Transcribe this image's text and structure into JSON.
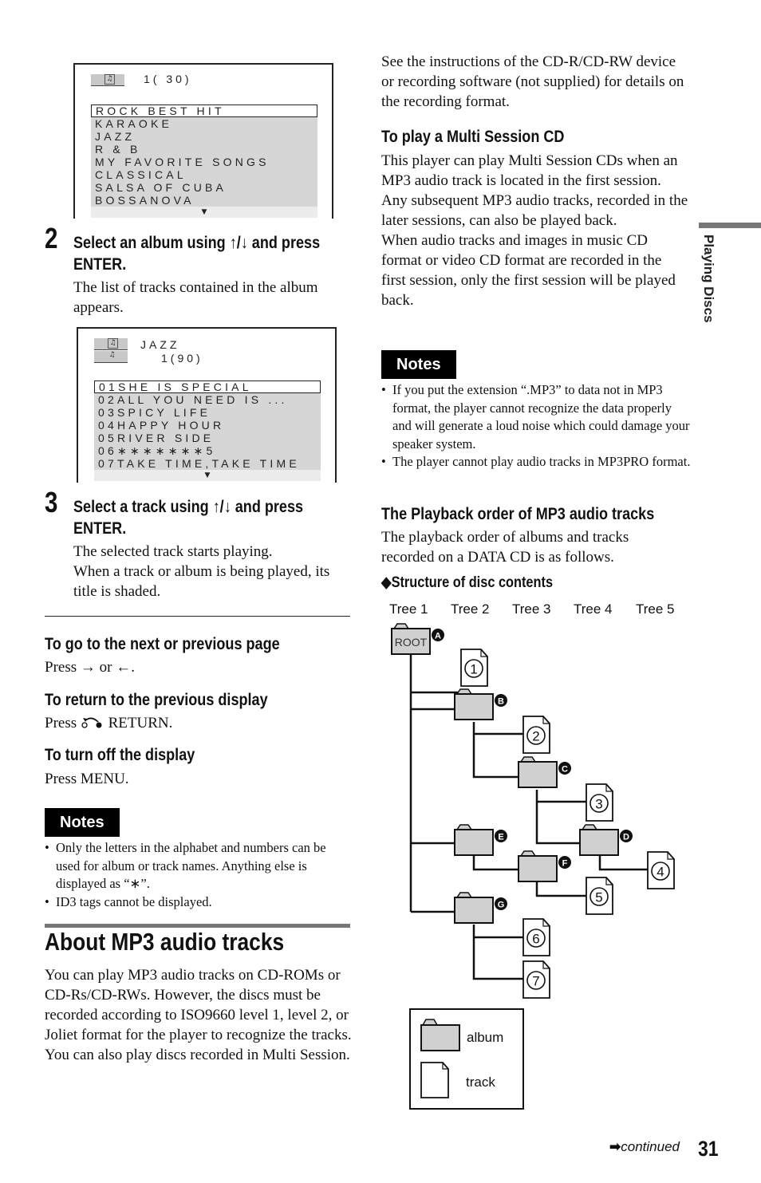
{
  "screen1": {
    "header_count": "1( 30)",
    "albums": [
      "ROCK BEST HIT",
      "KARAOKE",
      "JAZZ",
      "R & B",
      "MY FAVORITE SONGS",
      "CLASSICAL",
      "SALSA OF CUBA",
      "BOSSANOVA"
    ],
    "selected_index": 0,
    "more_indicator": "▼"
  },
  "step2": {
    "number": "2",
    "heading": "Select an album using ↑/↓ and press ENTER.",
    "heading_line1": "Select an album using ↑/↓ and press",
    "heading_line2": "ENTER.",
    "body_line1": "The list of tracks contained in the album",
    "body_line2": "appears."
  },
  "screen2": {
    "album_name": "JAZZ",
    "header_count": "1(90)",
    "tracks": [
      "01SHE IS SPECIAL",
      "02ALL YOU NEED IS ...",
      "03SPICY LIFE",
      "04HAPPY HOUR",
      "05RIVER SIDE",
      "06∗∗∗∗∗∗∗5",
      "07TAKE TIME,TAKE TIME"
    ],
    "selected_index": 0,
    "more_indicator": "▼"
  },
  "step3": {
    "number": "3",
    "heading_line1": "Select a track using ↑/↓ and press",
    "heading_line2": "ENTER.",
    "body_line1": "The selected track starts playing.",
    "body_line2": "When a track or album is being played, its",
    "body_line3": "title is shaded."
  },
  "tips": [
    {
      "heading": "To go to the next or previous page",
      "body": "Press → or ←."
    },
    {
      "heading": "To return to the previous display",
      "body_prefix": "Press",
      "body_suffix": "RETURN.",
      "icon": "return-icon"
    },
    {
      "heading": "To turn off the display",
      "body": "Press MENU."
    }
  ],
  "notes_left": {
    "badge": "Notes",
    "items": [
      "Only the letters in the alphabet and numbers can be used for album or track names. Anything else is displayed as “∗”.",
      "ID3 tags cannot be displayed."
    ]
  },
  "about": {
    "title": "About MP3 audio tracks",
    "para1": "You can play MP3 audio tracks on CD-ROMs or CD-Rs/CD-RWs. However, the discs must be recorded according to ISO9660 level 1, level 2, or Joliet format for the player to recognize the tracks.",
    "para2": "You can also play discs recorded in Multi Session."
  },
  "right": {
    "intro": "See the instructions of the CD-R/CD-RW device or recording software (not supplied) for details on the recording format.",
    "multi_session_heading": "To play a Multi Session CD",
    "multi_session_p1": "This player can play Multi Session CDs when an MP3 audio track is located in the first session. Any subsequent MP3 audio tracks, recorded in the later sessions, can also be played back.",
    "multi_session_p2": "When audio tracks and images in music CD format or video CD format are recorded in the first session, only the first session will be played back."
  },
  "notes_right": {
    "badge": "Notes",
    "items": [
      "If you put the extension “.MP3” to data not in MP3 format, the player cannot recognize the data properly and will generate a loud noise which could damage your speaker system.",
      "The player cannot play audio tracks in MP3PRO format."
    ]
  },
  "playback": {
    "heading": "The Playback order of MP3 audio tracks",
    "body": "The playback order of albums and tracks recorded on a DATA CD is as follows.",
    "structure_heading": "◆Structure of disc contents",
    "tree_labels": [
      "Tree 1",
      "Tree 2",
      "Tree 3",
      "Tree 4",
      "Tree 5"
    ],
    "root_label": "ROOT",
    "albums": [
      "A",
      "B",
      "C",
      "D",
      "E",
      "F",
      "G"
    ],
    "tracks": [
      "1",
      "2",
      "3",
      "4",
      "5",
      "6",
      "7"
    ],
    "legend": {
      "album": "album",
      "track": "track"
    }
  },
  "side_tab": "Playing Discs",
  "footer": {
    "continued": "continued",
    "page_number": "31"
  }
}
